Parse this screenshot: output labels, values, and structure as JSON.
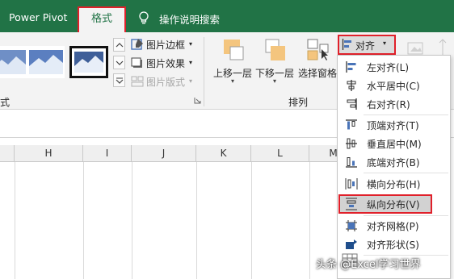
{
  "tabs": {
    "power_pivot": "Power Pivot",
    "format": "格式",
    "tell_me": "操作说明搜索"
  },
  "ribbon": {
    "picture_border": "图片边框",
    "picture_effects": "图片效果",
    "picture_layout": "图片版式",
    "styles_group_label_fragment": "式",
    "bring_forward": "上移一层",
    "send_backward": "下移一层",
    "selection_pane": "选择窗格",
    "arrange_group_label": "排列",
    "align_button": "对齐"
  },
  "columns": [
    "H",
    "I",
    "J",
    "K",
    "L",
    "M"
  ],
  "align_menu": {
    "items": [
      {
        "label": "左对齐(L)",
        "icon": "align-left-icon"
      },
      {
        "label": "水平居中(C)",
        "icon": "align-center-icon"
      },
      {
        "label": "右对齐(R)",
        "icon": "align-right-icon"
      },
      {
        "label": "顶端对齐(T)",
        "icon": "align-top-icon"
      },
      {
        "label": "垂直居中(M)",
        "icon": "align-middle-icon"
      },
      {
        "label": "底端对齐(B)",
        "icon": "align-bottom-icon"
      },
      {
        "label": "横向分布(H)",
        "icon": "distribute-horizontal-icon"
      },
      {
        "label": "纵向分布(V)",
        "icon": "distribute-vertical-icon"
      },
      {
        "label": "对齐网格(P)",
        "icon": "snap-to-grid-icon"
      },
      {
        "label": "对齐形状(S)",
        "icon": "snap-to-shape-icon"
      }
    ],
    "highlighted": "纵向分布(V)"
  },
  "watermark": "头条 @Excel学习世界",
  "colors": {
    "tab_bar": "#217346",
    "highlight_outline": "#e0202a",
    "ribbon_bg": "#f3f3f3"
  }
}
